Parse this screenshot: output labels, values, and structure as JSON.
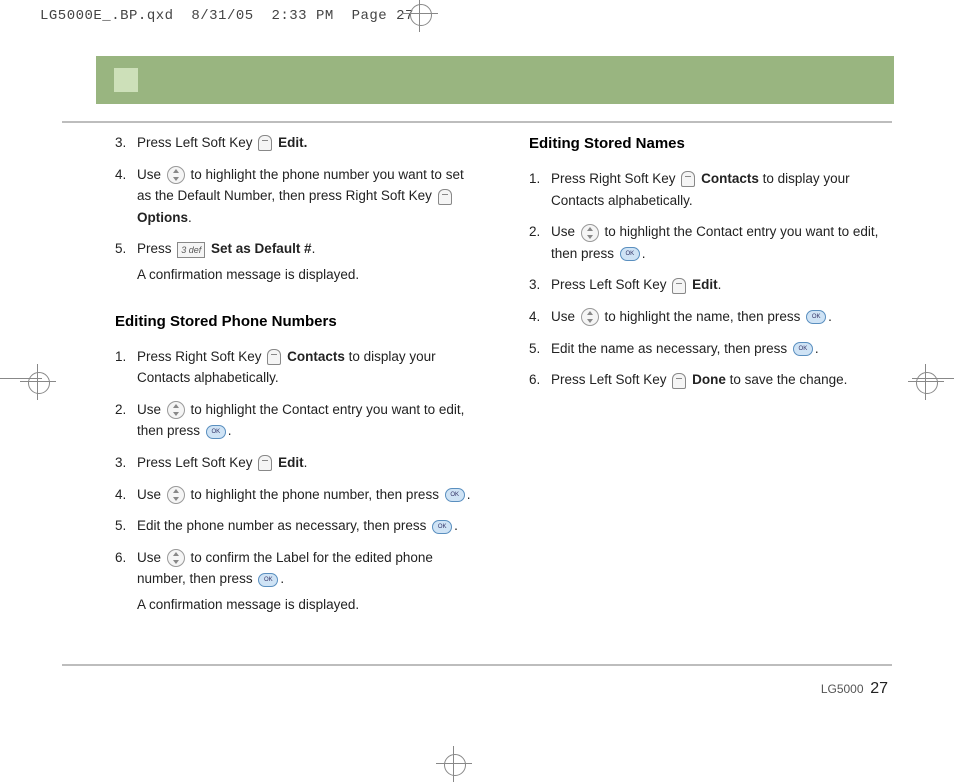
{
  "header": {
    "filename": "LG5000E_.BP.qxd",
    "date": "8/31/05",
    "time": "2:33 PM",
    "page_label": "Page 27"
  },
  "footer": {
    "model": "LG5000",
    "page_number": "27"
  },
  "left_column": {
    "steps_a": [
      {
        "n": "3.",
        "pre": "Press Left Soft Key ",
        "icon": "soft",
        "post": " ",
        "bold": "Edit.",
        "tail": ""
      },
      {
        "n": "4.",
        "pre": "Use ",
        "icon": "nav",
        "post": " to highlight the phone number you want to set as the Default Number, then press Right Soft Key ",
        "icon2": "soft",
        "post2": " ",
        "bold": "Options",
        "tail": "."
      },
      {
        "n": "5.",
        "pre": "Press ",
        "icon": "key3",
        "post": " ",
        "bold": "Set as Default #",
        "tail": ".",
        "extra": "A confirmation message is displayed."
      }
    ],
    "section_title": "Editing Stored Phone Numbers",
    "steps_b": [
      {
        "n": "1.",
        "pre": "Press Right Soft Key ",
        "icon": "soft",
        "post": " ",
        "bold": "Contacts",
        "tail": " to display your Contacts alphabetically."
      },
      {
        "n": "2.",
        "pre": "Use ",
        "icon": "nav",
        "post": " to highlight the Contact entry you want to edit, then press ",
        "icon2": "ok",
        "post2": "."
      },
      {
        "n": "3.",
        "pre": "Press Left Soft Key ",
        "icon": "soft",
        "post": " ",
        "bold": "Edit",
        "tail": "."
      },
      {
        "n": "4.",
        "pre": "Use ",
        "icon": "nav",
        "post": " to highlight the phone number, then press ",
        "icon2": "ok",
        "post2": "."
      },
      {
        "n": "5.",
        "pre": "Edit the phone number as necessary, then press ",
        "icon": "ok",
        "post": "."
      },
      {
        "n": "6.",
        "pre": "Use ",
        "icon": "nav",
        "post": " to confirm the Label for the edited phone number, then press ",
        "icon2": "ok",
        "post2": ".",
        "extra": "A confirmation message is displayed."
      }
    ]
  },
  "right_column": {
    "section_title": "Editing Stored Names",
    "steps": [
      {
        "n": "1.",
        "pre": "Press Right Soft Key ",
        "icon": "soft",
        "post": " ",
        "bold": "Contacts",
        "tail": " to display your Contacts alphabetically."
      },
      {
        "n": "2.",
        "pre": "Use ",
        "icon": "nav",
        "post": " to highlight the Contact entry you want to edit, then press ",
        "icon2": "ok",
        "post2": "."
      },
      {
        "n": "3.",
        "pre": "Press Left Soft Key ",
        "icon": "soft",
        "post": " ",
        "bold": "Edit",
        "tail": "."
      },
      {
        "n": "4.",
        "pre": "Use ",
        "icon": "nav",
        "post": " to highlight the name, then press ",
        "icon2": "ok",
        "post2": "."
      },
      {
        "n": "5.",
        "pre": "Edit the name as necessary, then press ",
        "icon": "ok",
        "post": "."
      },
      {
        "n": "6.",
        "pre": "Press Left Soft Key ",
        "icon": "soft",
        "post": " ",
        "bold": "Done",
        "tail": " to save the change."
      }
    ]
  }
}
